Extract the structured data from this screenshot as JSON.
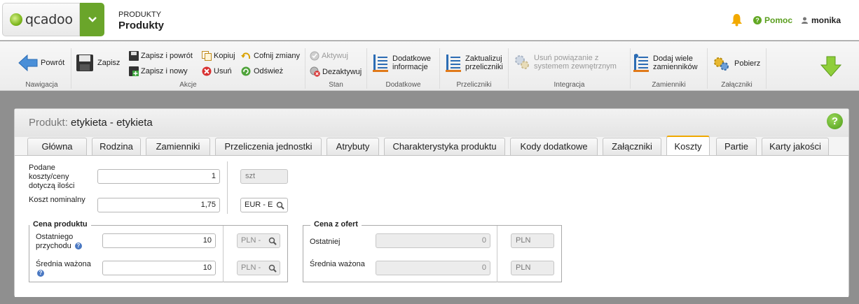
{
  "header": {
    "logo_text": "qcadoo",
    "module": "PRODUKTY",
    "title": "Produkty",
    "help_label": "Pomoc",
    "user": "monika"
  },
  "ribbon": {
    "groups": {
      "nawigacja": "Nawigacja",
      "akcje": "Akcje",
      "stan": "Stan",
      "dodatkowe": "Dodatkowe",
      "przeliczniki": "Przeliczniki",
      "integracja": "Integracja",
      "zamienniki": "Zamienniki",
      "zalaczniki": "Załączniki"
    },
    "buttons": {
      "back": "Powrót",
      "save": "Zapisz",
      "save_back": "Zapisz i powrót",
      "save_new": "Zapisz i nowy",
      "copy": "Kopiuj",
      "undo": "Cofnij zmiany",
      "delete": "Usuń",
      "refresh": "Odśwież",
      "activate": "Aktywuj",
      "deactivate": "Dezaktywuj",
      "extra_info": "Dodatkowe informacje",
      "update_converters": "Zaktualizuj przeliczniki",
      "remove_links": "Usuń powiązanie z systemem zewnętrznym",
      "add_many_substitutes": "Dodaj wiele zamienników",
      "download": "Pobierz"
    }
  },
  "panel": {
    "title_prefix": "Produkt:",
    "title": "etykieta - etykieta",
    "help_icon": "?",
    "tabs": [
      "Główna",
      "Rodzina",
      "Zamienniki",
      "Przeliczenia jednostki",
      "Atrybuty",
      "Charakterystyka produktu",
      "Kody dodatkowe",
      "Załączniki",
      "Koszty",
      "Partie",
      "Karty jakości"
    ],
    "active_tab": "Koszty"
  },
  "costs": {
    "quantity_label": "Podane kosztу/ceny dotyczą ilości",
    "quantity_value": "1",
    "quantity_unit": "szt",
    "nominal_label": "Koszt nominalny",
    "nominal_value": "1,75",
    "nominal_currency": "EUR - E",
    "product_price": {
      "legend": "Cena produktu",
      "last_label": "Ostatniego przychodu",
      "last_value": "10",
      "last_currency": "PLN -",
      "avg_label": "Średnia ważona",
      "avg_value": "10",
      "avg_currency": "PLN -"
    },
    "offer_price": {
      "legend": "Cena z ofert",
      "last_label": "Ostatniej",
      "last_value": "0",
      "last_currency": "PLN",
      "avg_label": "Średnia ważona",
      "avg_value": "0",
      "avg_currency": "PLN"
    }
  },
  "colors": {
    "brand_green": "#6aa52a",
    "active_tab_accent": "#f0a800"
  }
}
